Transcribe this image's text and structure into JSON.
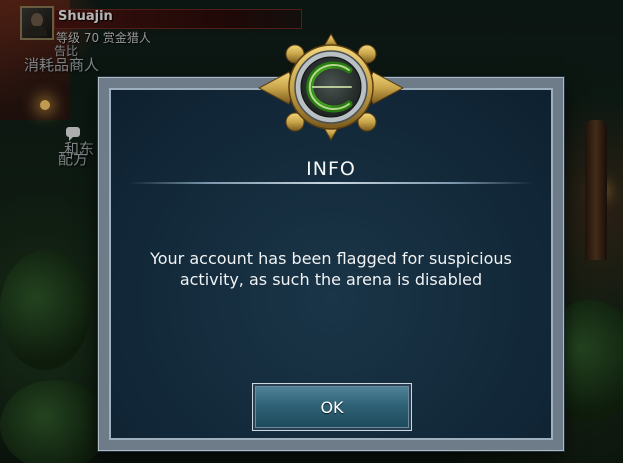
{
  "hud": {
    "player_name": "Shuajin",
    "player_subtitle": "等级 70  赏金猎人"
  },
  "npcs": [
    {
      "label": "消耗品商人"
    },
    {
      "label": "告比"
    },
    {
      "label": "和东"
    },
    {
      "label": "配方"
    }
  ],
  "dialog": {
    "title": "INFO",
    "message_line1": "Your account has been flagged for suspicious",
    "message_line2": "activity, as such the arena is disabled",
    "ok_label": "OK",
    "emblem_icon": "green-rune-emblem-icon"
  },
  "colors": {
    "dialog_bg": "#132a3a",
    "button_top": "#4f8296",
    "emblem_glow": "#7cff3a",
    "gold": "#c9a54a"
  }
}
